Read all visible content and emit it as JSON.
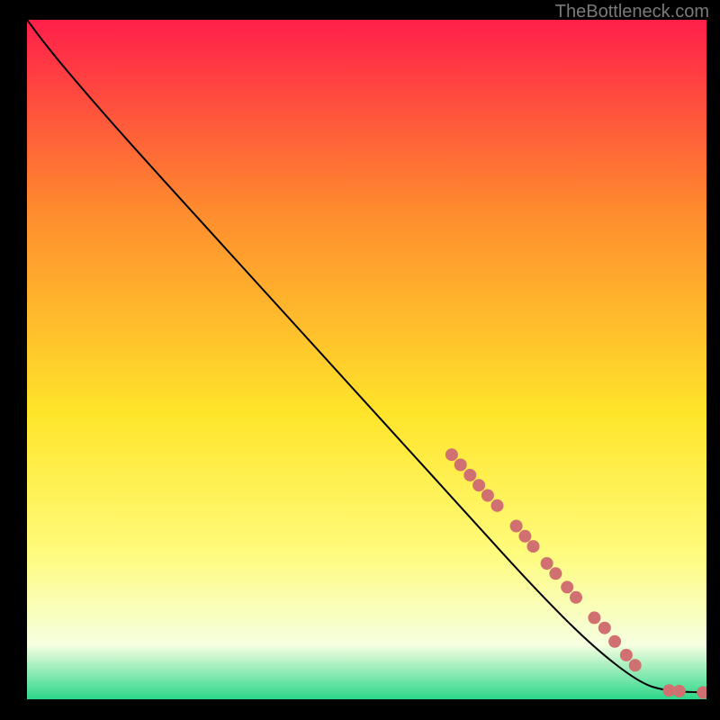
{
  "watermark": "TheBottleneck.com",
  "chart_data": {
    "type": "line",
    "title": "",
    "xlabel": "",
    "ylabel": "",
    "xlim": [
      0,
      100
    ],
    "ylim": [
      0,
      100
    ],
    "background_gradient": {
      "top": "#ff1f4a",
      "upper_mid": "#ff8b2e",
      "mid": "#ffe52a",
      "lower_mid": "#fffb7a",
      "low": "#f6ffe0",
      "bottom": "#2bd78a"
    },
    "curve": [
      {
        "x": 0,
        "y": 100
      },
      {
        "x": 3,
        "y": 96
      },
      {
        "x": 8,
        "y": 90
      },
      {
        "x": 15,
        "y": 82
      },
      {
        "x": 25,
        "y": 71
      },
      {
        "x": 35,
        "y": 60
      },
      {
        "x": 45,
        "y": 49
      },
      {
        "x": 55,
        "y": 38
      },
      {
        "x": 65,
        "y": 27
      },
      {
        "x": 75,
        "y": 16
      },
      {
        "x": 83,
        "y": 8
      },
      {
        "x": 90,
        "y": 2.5
      },
      {
        "x": 94,
        "y": 1.2
      },
      {
        "x": 100,
        "y": 1.0
      }
    ],
    "markers": [
      {
        "x": 62.5,
        "y": 36.0
      },
      {
        "x": 63.8,
        "y": 34.5
      },
      {
        "x": 65.2,
        "y": 33.0
      },
      {
        "x": 66.5,
        "y": 31.5
      },
      {
        "x": 67.8,
        "y": 30.0
      },
      {
        "x": 69.2,
        "y": 28.5
      },
      {
        "x": 72.0,
        "y": 25.5
      },
      {
        "x": 73.3,
        "y": 24.0
      },
      {
        "x": 74.5,
        "y": 22.5
      },
      {
        "x": 76.5,
        "y": 20.0
      },
      {
        "x": 77.8,
        "y": 18.5
      },
      {
        "x": 79.5,
        "y": 16.5
      },
      {
        "x": 80.8,
        "y": 15.0
      },
      {
        "x": 83.5,
        "y": 12.0
      },
      {
        "x": 85.0,
        "y": 10.5
      },
      {
        "x": 86.5,
        "y": 8.5
      },
      {
        "x": 88.2,
        "y": 6.5
      },
      {
        "x": 89.5,
        "y": 5.0
      },
      {
        "x": 94.5,
        "y": 1.3
      },
      {
        "x": 96.0,
        "y": 1.2
      },
      {
        "x": 99.5,
        "y": 1.0
      }
    ],
    "marker_color": "#d07070",
    "curve_color": "#000000"
  }
}
